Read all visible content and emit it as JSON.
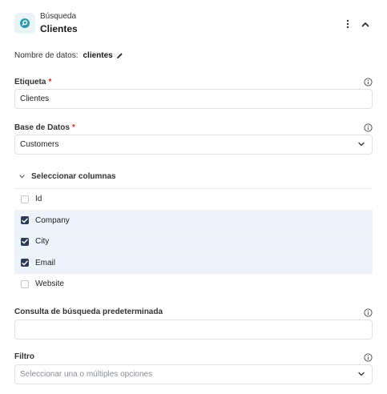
{
  "header": {
    "subtitle": "Búsqueda",
    "title": "Clientes"
  },
  "dataname": {
    "label": "Nombre de datos:",
    "value": "clientes"
  },
  "etiqueta": {
    "label": "Etiqueta",
    "required_mark": "*",
    "value": "Clientes"
  },
  "base": {
    "label": "Base de Datos",
    "required_mark": "*",
    "value": "Customers"
  },
  "columns": {
    "toggle_label": "Seleccionar columnas",
    "items": [
      {
        "label": "Id",
        "checked": false
      },
      {
        "label": "Company",
        "checked": true
      },
      {
        "label": "City",
        "checked": true
      },
      {
        "label": "Email",
        "checked": true
      },
      {
        "label": "Website",
        "checked": false
      }
    ]
  },
  "consulta": {
    "label": "Consulta de búsqueda predeterminada",
    "value": ""
  },
  "filtro": {
    "label": "Filtro",
    "placeholder": "Seleccionar una o múltiples opciones"
  },
  "colors": {
    "accent": "#2f3b52",
    "checked_row": "#edf3fb",
    "required": "#d92d20",
    "icon_teal": "#2a9aa8"
  }
}
